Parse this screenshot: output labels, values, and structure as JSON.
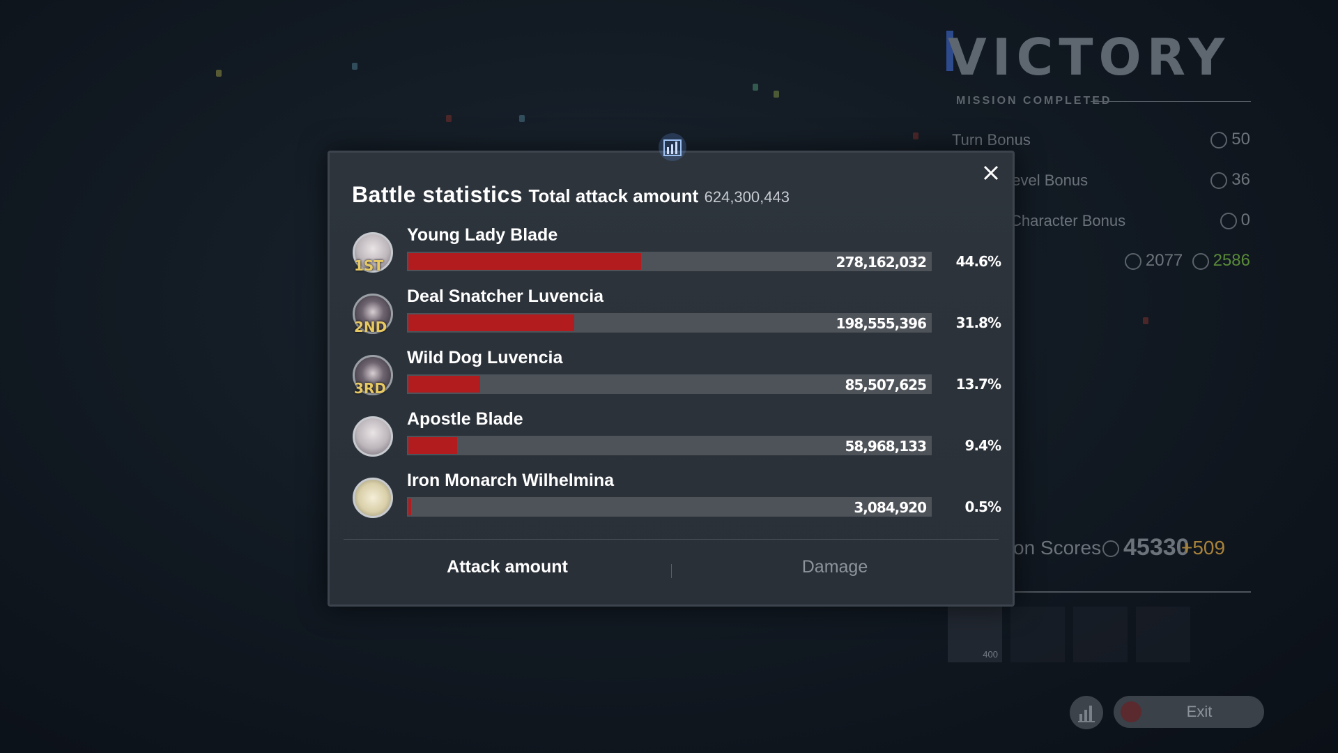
{
  "background": {
    "victory_title": "VICTORY",
    "mission_completed": "MISSION COMPLETED",
    "bonuses": [
      {
        "label": "Turn Bonus",
        "value": "50"
      },
      {
        "label": "Level Bonus",
        "value": "36"
      },
      {
        "label": "Character Bonus",
        "value": "0"
      }
    ],
    "totals": {
      "base": "2077",
      "final": "2586"
    },
    "scores": {
      "label": "son Scores",
      "value": "45330",
      "delta": "+509"
    },
    "reward_count": "400",
    "exit_label": "Exit",
    "colors": {
      "final_green": "#5a8a3a",
      "delta_gold": "#a8823a"
    }
  },
  "modal": {
    "title": "Battle statistics",
    "subtitle": "Total attack amount",
    "total_value": "624,300,443",
    "rows": [
      {
        "rank": "1ST",
        "name": "Young Lady Blade",
        "value": "278,162,032",
        "percent": "44.6%",
        "share": 0.446
      },
      {
        "rank": "2ND",
        "name": "Deal Snatcher Luvencia",
        "value": "198,555,396",
        "percent": "31.8%",
        "share": 0.318
      },
      {
        "rank": "3RD",
        "name": "Wild Dog Luvencia",
        "value": "85,507,625",
        "percent": "13.7%",
        "share": 0.137
      },
      {
        "rank": "",
        "name": "Apostle Blade",
        "value": "58,968,133",
        "percent": "9.4%",
        "share": 0.094
      },
      {
        "rank": "",
        "name": "Iron Monarch Wilhelmina",
        "value": "3,084,920",
        "percent": "0.5%",
        "share": 0.005
      }
    ],
    "tabs": {
      "attack": "Attack amount",
      "damage": "Damage"
    },
    "icons": {
      "header": "bar-chart-icon",
      "close": "close-icon"
    },
    "colors": {
      "bar_fill": "#b21c1f",
      "bar_track": "#4e535a",
      "rank_gold": "#e7c964"
    }
  }
}
